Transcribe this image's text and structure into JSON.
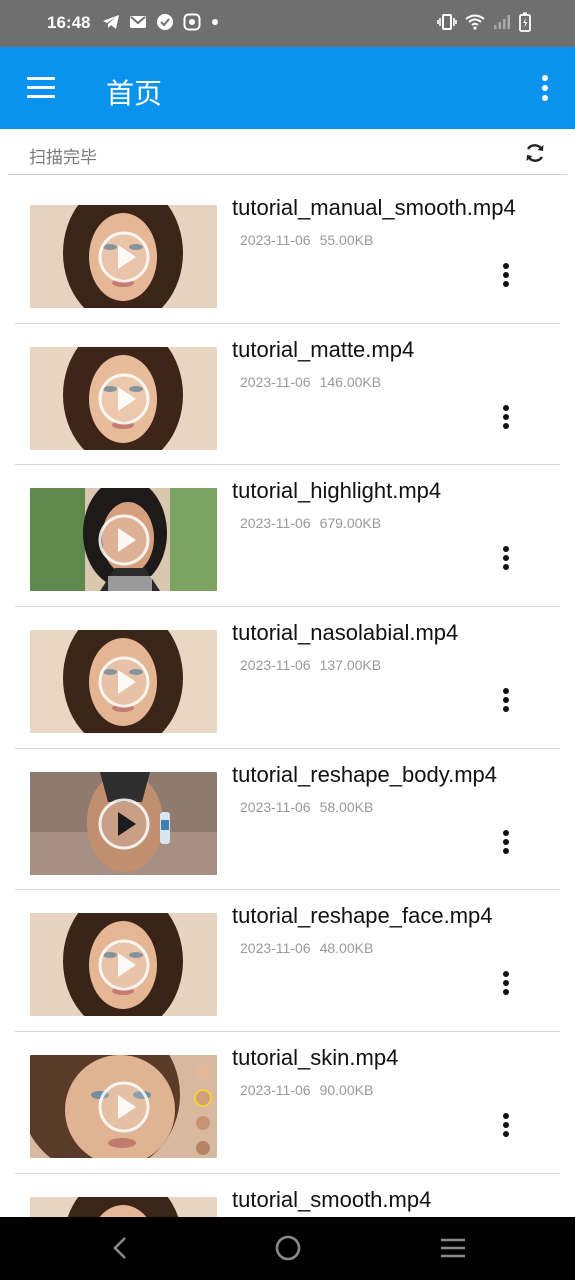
{
  "status_bar": {
    "time": "16:48",
    "left_icons": [
      "telegram-icon",
      "gmail-icon",
      "check-icon",
      "app-icon",
      "dot-icon"
    ],
    "right_icons": [
      "vibrate-icon",
      "wifi-icon",
      "signal-icon",
      "battery-charging-icon"
    ]
  },
  "app_bar": {
    "title": "首页",
    "menu_icon": "hamburger-menu-icon",
    "more_icon": "more-vert-icon",
    "background": "#0a93ee"
  },
  "scan_bar": {
    "status_text": "扫描完毕",
    "refresh_icon": "refresh-icon"
  },
  "videos": [
    {
      "name": "tutorial_manual_smooth.mp4",
      "date": "2023-11-06",
      "size": "55.00KB"
    },
    {
      "name": "tutorial_matte.mp4",
      "date": "2023-11-06",
      "size": "146.00KB"
    },
    {
      "name": "tutorial_highlight.mp4",
      "date": "2023-11-06",
      "size": "679.00KB"
    },
    {
      "name": "tutorial_nasolabial.mp4",
      "date": "2023-11-06",
      "size": "137.00KB"
    },
    {
      "name": "tutorial_reshape_body.mp4",
      "date": "2023-11-06",
      "size": "58.00KB"
    },
    {
      "name": "tutorial_reshape_face.mp4",
      "date": "2023-11-06",
      "size": "48.00KB"
    },
    {
      "name": "tutorial_skin.mp4",
      "date": "2023-11-06",
      "size": "90.00KB"
    },
    {
      "name": "tutorial_smooth.mp4",
      "date": "",
      "size": ""
    }
  ],
  "nav_bar": {
    "icons": [
      "back-icon",
      "home-icon",
      "recents-icon"
    ]
  }
}
